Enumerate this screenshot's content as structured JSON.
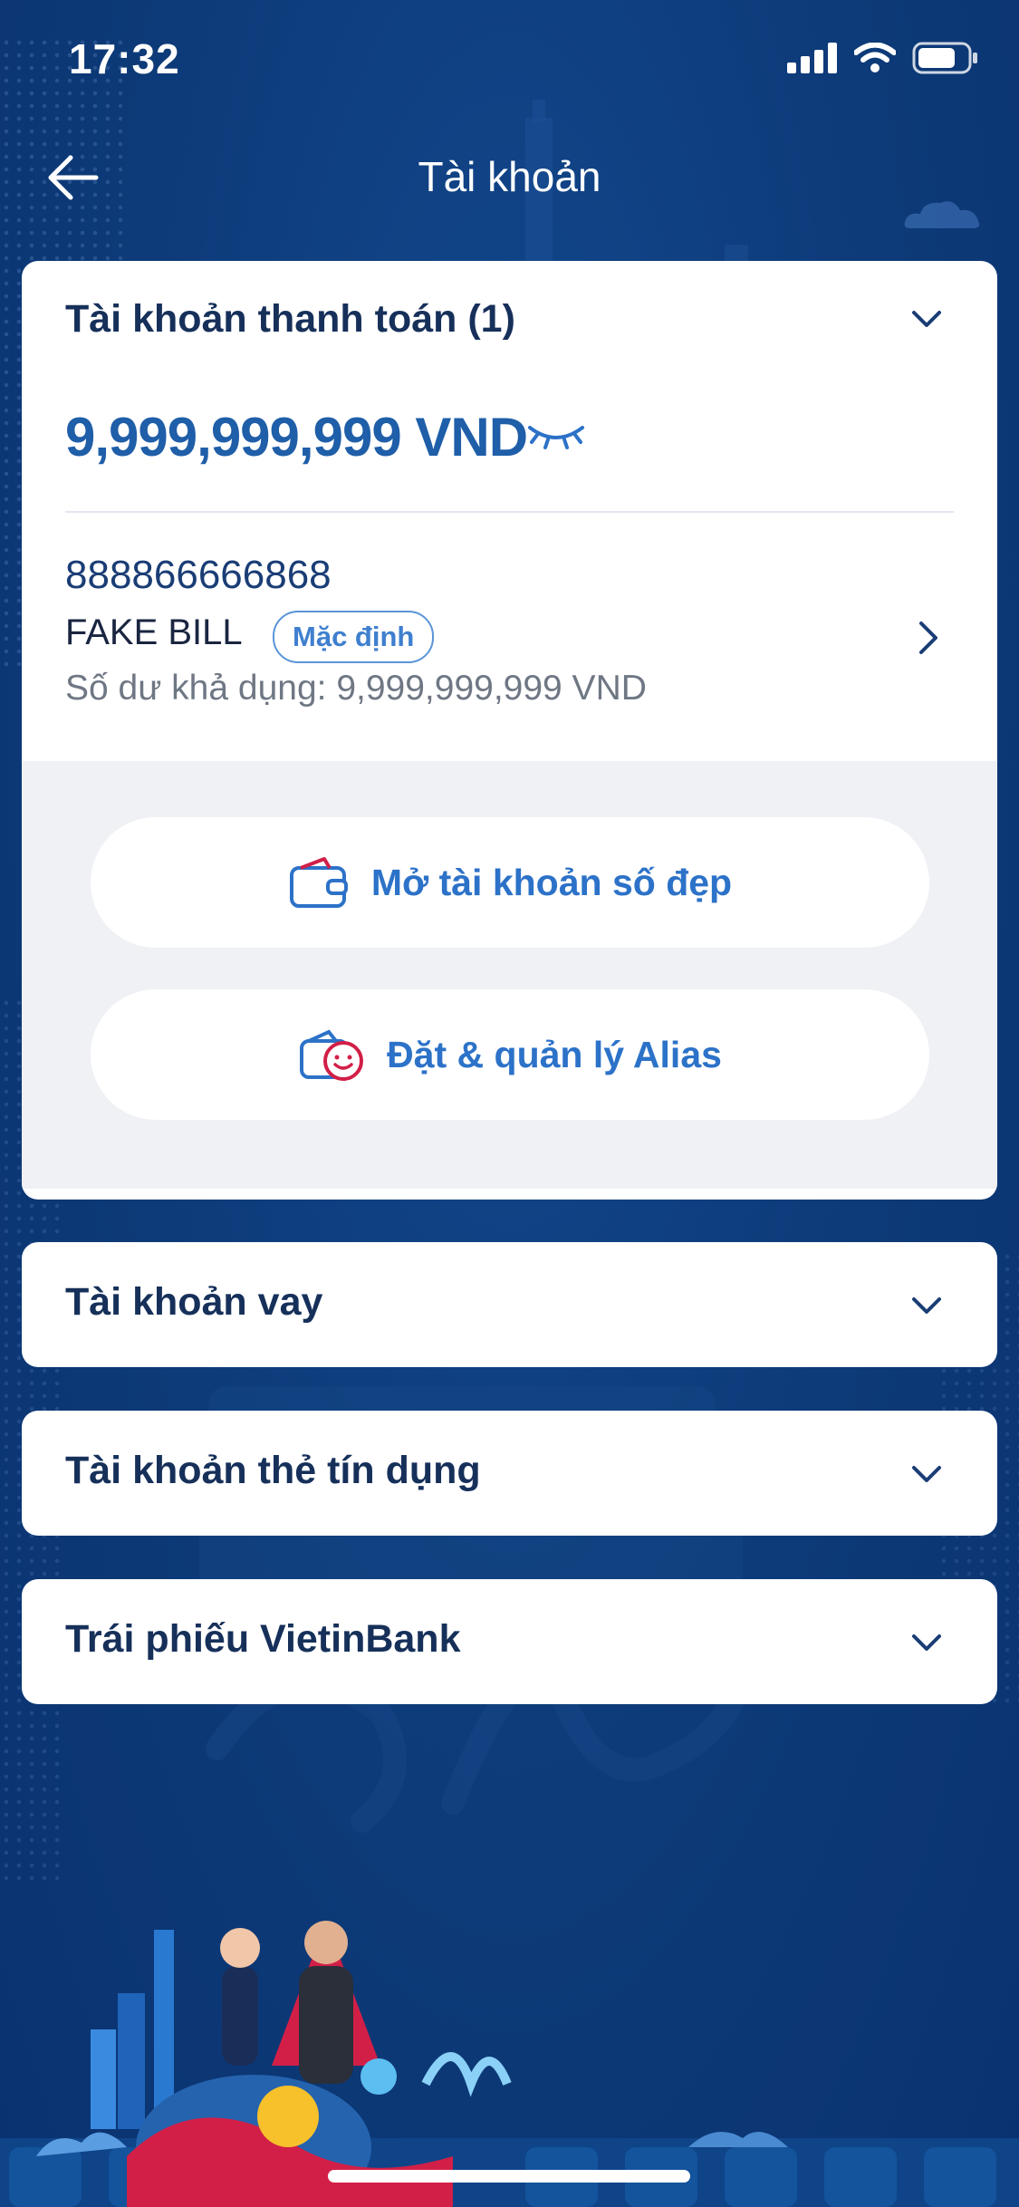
{
  "status_bar": {
    "time": "17:32"
  },
  "header": {
    "title": "Tài khoản"
  },
  "payment_account": {
    "heading": "Tài khoản thanh toán (1)",
    "balance": "9,999,999,999 VND",
    "account_number": "888866666868",
    "account_name": "FAKE BILL",
    "default_badge": "Mặc định",
    "available_balance": "Số dư khả dụng: 9,999,999,999 VND",
    "actions": [
      {
        "label": "Mở tài khoản số đẹp",
        "icon": "wallet-icon"
      },
      {
        "label": "Đặt & quản lý Alias",
        "icon": "smile-wallet-icon"
      }
    ]
  },
  "sections": [
    {
      "label": "Tài khoản vay"
    },
    {
      "label": "Tài khoản thẻ tín dụng"
    },
    {
      "label": "Trái phiếu VietinBank"
    }
  ],
  "colors": {
    "background": "#0d3a78",
    "accent": "#2c72c8",
    "heading": "#16305a",
    "balance": "#1f5ea8",
    "badge": "#3f7fcf",
    "promo_red": "#d21f47"
  }
}
